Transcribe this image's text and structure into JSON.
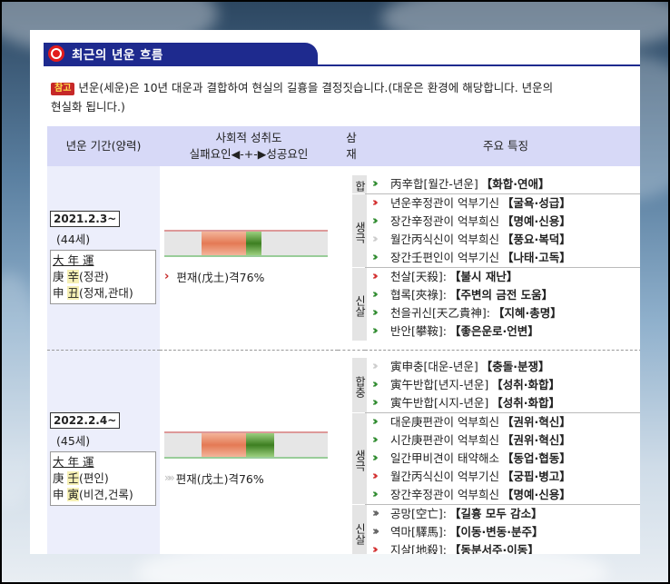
{
  "title": "최근의 년운 흐름",
  "note": {
    "badge": "참고",
    "line1": "년운(세운)은 10년 대운과 결합하여 현실의 길흉을 결정짓습니다.(대운은 환경에 해당합니다. 년운의",
    "line2": "현실화 됩니다.)"
  },
  "headers": {
    "period": "년운 기간(양력)",
    "bar_line1": "사회적 성취도",
    "bar_line2": "실패요인◀-+-▶성공요인",
    "sam": "삼재",
    "main": "주요 특징"
  },
  "rows": [
    {
      "date": "2021.2.3~",
      "age": "(44세)",
      "pillars": [
        "大 年 運",
        "庚 辛(정관)",
        "申 丑(정재,관대)"
      ],
      "bar_fill": [
        0.45,
        0.15
      ],
      "bar_text": "편재(戊土)격76%",
      "bar_mark": "red",
      "groups": [
        {
          "label": "합",
          "items": [
            {
              "mark": "g",
              "text": "丙辛합[월간-년운]",
              "tag": "【화합·연애】"
            }
          ]
        },
        {
          "label": "생극",
          "items": [
            {
              "mark": "r",
              "text": "년운辛정관이 억부기신",
              "tag": "【굴욕·성급】"
            },
            {
              "mark": "g",
              "text": "장간辛정관이 억부희신",
              "tag": "【명예·신용】"
            },
            {
              "mark": "w",
              "text": "월간丙식신이 억부희신",
              "tag": "【풍요·복덕】"
            },
            {
              "mark": "g",
              "text": "장간壬편인이 억부기신",
              "tag": "【나태·고독】"
            }
          ]
        },
        {
          "label": "신살",
          "items": [
            {
              "mark": "r",
              "text": "천살[天殺]:",
              "tag": "【불시 재난】"
            },
            {
              "mark": "g",
              "text": "협록[夾祿]:",
              "tag": "【주변의 금전 도움】"
            },
            {
              "mark": "g",
              "text": "천을귀신[天乙貴神]:",
              "tag": "【지혜·총명】"
            },
            {
              "mark": "g",
              "text": "반안[攀鞍]:",
              "tag": "【좋은운로·언변】"
            }
          ]
        }
      ]
    },
    {
      "date": "2022.2.4~",
      "age": "(45세)",
      "pillars": [
        "大 年 運",
        "庚 壬(편인)",
        "申 寅(비견,건록)"
      ],
      "bar_fill": [
        0.45,
        0.3
      ],
      "bar_text": "편재(戊土)격76%",
      "bar_mark": "grey",
      "groups": [
        {
          "label": "합충",
          "items": [
            {
              "mark": "w",
              "text": "寅申충[대운-년운]",
              "tag": "【충돌·분쟁】"
            },
            {
              "mark": "g",
              "text": "寅午반합[년지-년운]",
              "tag": "【성취·화합】"
            },
            {
              "mark": "g",
              "text": "寅午반합[시지-년운]",
              "tag": "【성취·화합】"
            }
          ]
        },
        {
          "label": "생극",
          "items": [
            {
              "mark": "g",
              "text": "대운庚편관이 억부희신",
              "tag": "【권위·혁신】"
            },
            {
              "mark": "g",
              "text": "시간庚편관이 억부희신",
              "tag": "【권위·혁신】"
            },
            {
              "mark": "g",
              "text": "일간甲비견이 태약해소",
              "tag": "【동업·협동】"
            },
            {
              "mark": "r",
              "text": "월간丙식신이 억부기신",
              "tag": "【궁핍·병고】"
            },
            {
              "mark": "g",
              "text": "장간辛정관이 억부희신",
              "tag": "【명예·신용】"
            }
          ]
        },
        {
          "label": "신살",
          "items": [
            {
              "mark": "k",
              "text": "공망[空亡]:",
              "tag": "【길흉 모두 감소】"
            },
            {
              "mark": "k",
              "text": "역마[驛馬]:",
              "tag": "【이동·변동·분주】"
            },
            {
              "mark": "r",
              "text": "지살[地殺]:",
              "tag": "【동분서주·이동】"
            }
          ]
        }
      ]
    }
  ]
}
